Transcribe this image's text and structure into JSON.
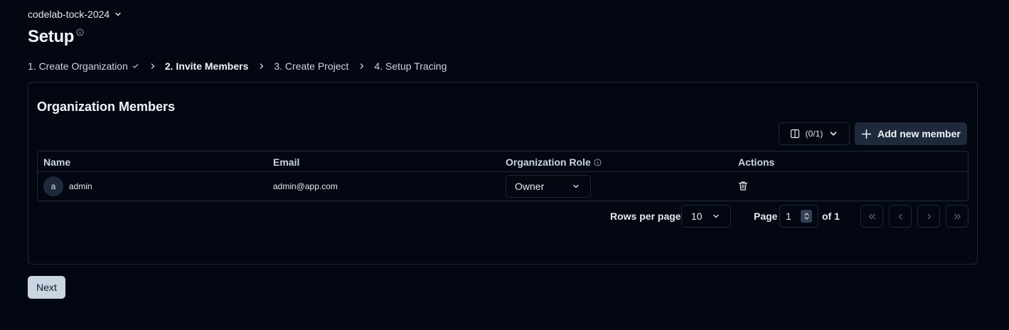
{
  "project_switcher": {
    "label": "codelab-tock-2024"
  },
  "page": {
    "title": "Setup"
  },
  "steps": [
    {
      "label": "1. Create Organization"
    },
    {
      "label": "2. Invite Members"
    },
    {
      "label": "3. Create Project"
    },
    {
      "label": "4. Setup Tracing"
    }
  ],
  "members_card": {
    "title": "Organization Members",
    "columns_button": "(0/1)",
    "add_button": "Add new member",
    "table": {
      "headers": {
        "name": "Name",
        "email": "Email",
        "role": "Organization Role",
        "actions": "Actions"
      },
      "rows": [
        {
          "avatar": "a",
          "name": "admin",
          "email": "admin@app.com",
          "role": "Owner"
        }
      ]
    },
    "pagination": {
      "rows_per_page_label": "Rows per page",
      "rows_per_page_value": "10",
      "page_label": "Page",
      "page_value": "1",
      "of_label": "of 1"
    }
  },
  "next_button": "Next",
  "colors": {
    "background": "#030711",
    "border": "#1e293b",
    "primary_button": "#cbd5e1"
  }
}
